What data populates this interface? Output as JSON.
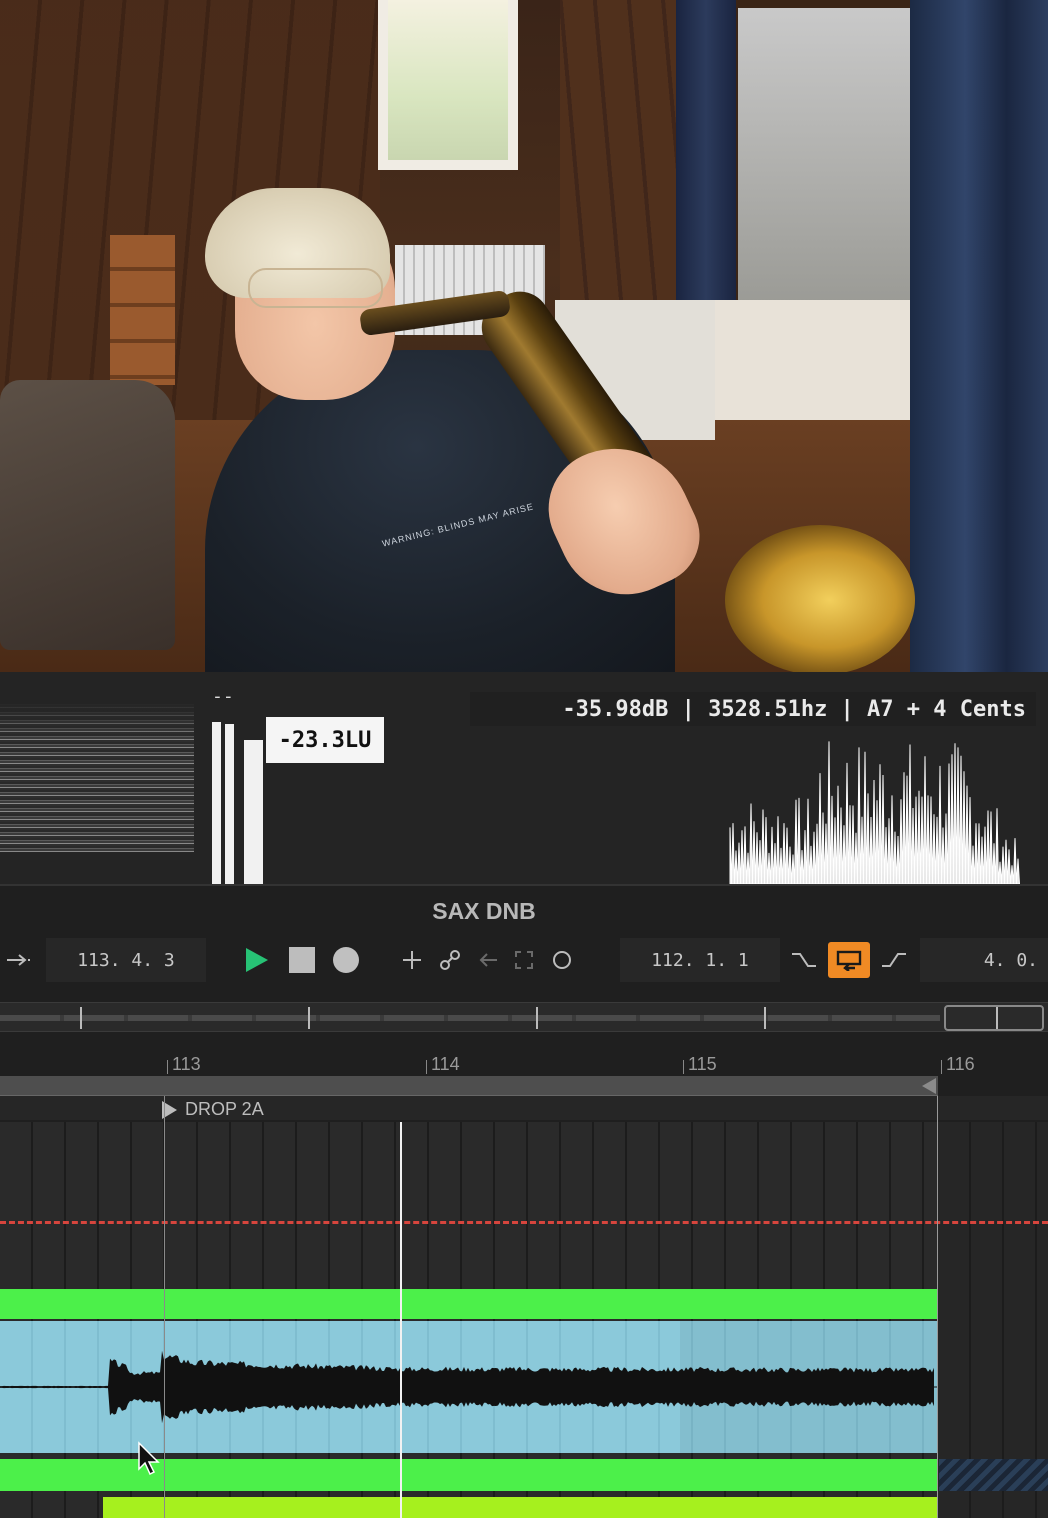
{
  "analyzer": {
    "meter_top_label": "--",
    "lufs": "-23.3LU",
    "readout": "-35.98dB | 3528.51hz | A7 + 4 Cents"
  },
  "daw": {
    "track_title": "SAX DNB",
    "transport": {
      "follow_icon": "arrow-to-bar-icon",
      "position": "113.  4.  3",
      "loop_start": "112.  1.  1",
      "loop_length": "4.  0.",
      "tools": [
        "plus-icon",
        "link-icon",
        "arrow-left-icon",
        "fullscreen-icon",
        "circle-icon"
      ],
      "loop_active_color": "#f08a24",
      "play_color": "#27c275"
    },
    "ruler": {
      "bars": [
        "113",
        "114",
        "115",
        "116"
      ]
    },
    "marker": "DROP 2A",
    "clip_colors": {
      "top": "#4cf04a",
      "body": "#8bc9da",
      "lime": "#a6f01e"
    },
    "automation_color": "#d6453d"
  },
  "video": {
    "hoodie_text": "WARNING: BLINDS MAY ARISE"
  }
}
